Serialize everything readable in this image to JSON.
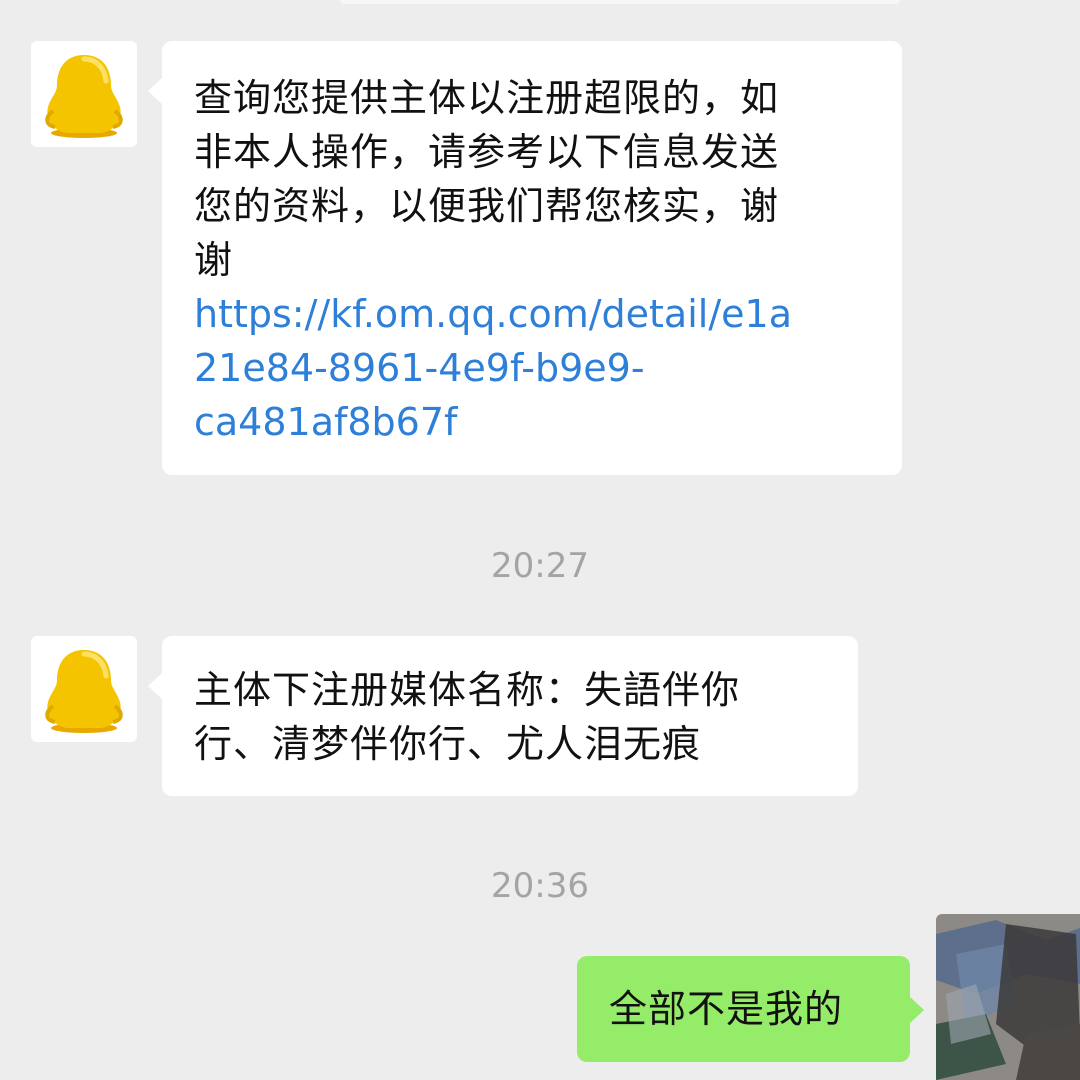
{
  "messages": [
    {
      "sender": "contact",
      "lines": [
        "查询您提供主体以注册超限的，如",
        "非本人操作，请参考以下信息发送",
        "您的资料，以便我们帮您核实，谢",
        "谢"
      ],
      "link_lines": [
        "https://kf.om.qq.com/detail/e1a",
        "21e84-8961-4e9f-b9e9-",
        "ca481af8b67f"
      ],
      "avatar_icon": "qq-penguin-icon"
    },
    {
      "type": "timestamp",
      "text": "20:27"
    },
    {
      "sender": "contact",
      "lines": [
        "主体下注册媒体名称：失語伴你",
        "行、清梦伴你行、尤人泪无痕"
      ],
      "avatar_icon": "qq-penguin-icon"
    },
    {
      "type": "timestamp",
      "text": "20:36"
    },
    {
      "sender": "self",
      "lines": [
        "全部不是我的"
      ],
      "avatar_icon": "user-avatar-icon"
    }
  ],
  "colors": {
    "background": "#ededed",
    "incoming_bubble": "#ffffff",
    "outgoing_bubble": "#95ec69",
    "link": "#2d7fd8",
    "timestamp": "#a4a4a4",
    "penguin": "#f5c400"
  }
}
